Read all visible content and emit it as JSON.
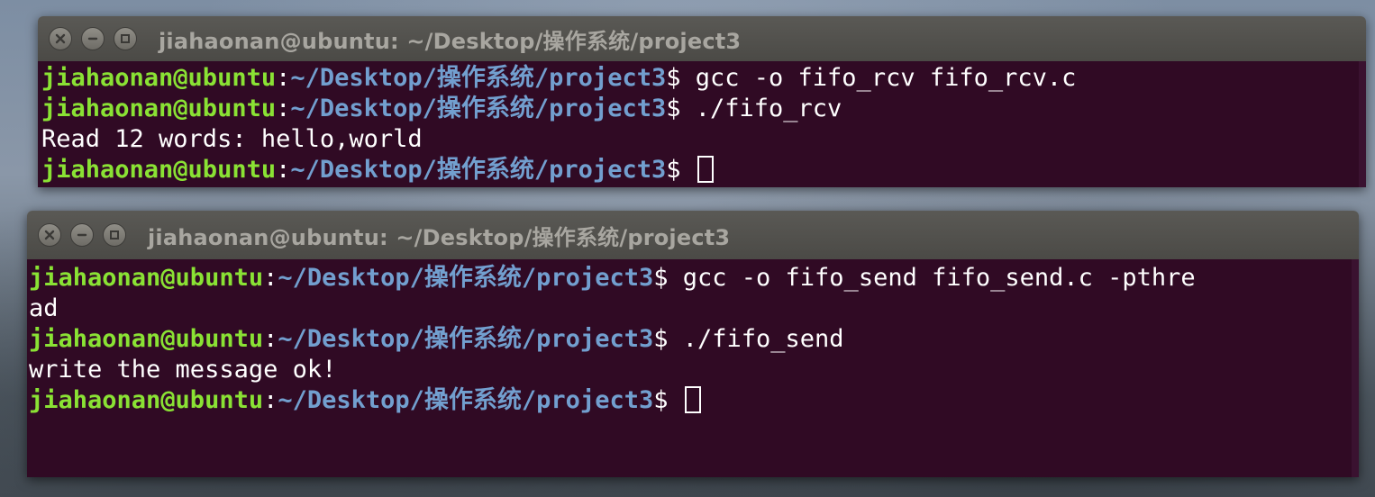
{
  "windows": [
    {
      "title": "jiahaonan@ubuntu: ~/Desktop/操作系统/project3",
      "lines": [
        {
          "type": "prompt",
          "user": "jiahaonan@ubuntu",
          "path": "~/Desktop/操作系统/project3",
          "cmd": "gcc -o fifo_rcv fifo_rcv.c"
        },
        {
          "type": "prompt",
          "user": "jiahaonan@ubuntu",
          "path": "~/Desktop/操作系统/project3",
          "cmd": "./fifo_rcv"
        },
        {
          "type": "output",
          "text": "Read 12 words: hello,world"
        },
        {
          "type": "prompt",
          "user": "jiahaonan@ubuntu",
          "path": "~/Desktop/操作系统/project3",
          "cmd": ""
        }
      ]
    },
    {
      "title": "jiahaonan@ubuntu: ~/Desktop/操作系统/project3",
      "lines": [
        {
          "type": "prompt",
          "user": "jiahaonan@ubuntu",
          "path": "~/Desktop/操作系统/project3",
          "cmd": "gcc -o fifo_send fifo_send.c -pthre"
        },
        {
          "type": "output",
          "text": "ad"
        },
        {
          "type": "prompt",
          "user": "jiahaonan@ubuntu",
          "path": "~/Desktop/操作系统/project3",
          "cmd": "./fifo_send"
        },
        {
          "type": "output",
          "text": "write the message ok!"
        },
        {
          "type": "prompt",
          "user": "jiahaonan@ubuntu",
          "path": "~/Desktop/操作系统/project3",
          "cmd": ""
        }
      ]
    }
  ],
  "prompt_symbols": {
    "colon": ":",
    "dollar": "$"
  },
  "colors": {
    "terminal_bg": "#300a24",
    "user": "#8ae234",
    "path": "#729fcf",
    "text": "#ffffff",
    "titlebar": "#4b4a46"
  },
  "icons": {
    "close": "close-icon",
    "minimize": "minimize-icon",
    "maximize": "maximize-icon"
  }
}
